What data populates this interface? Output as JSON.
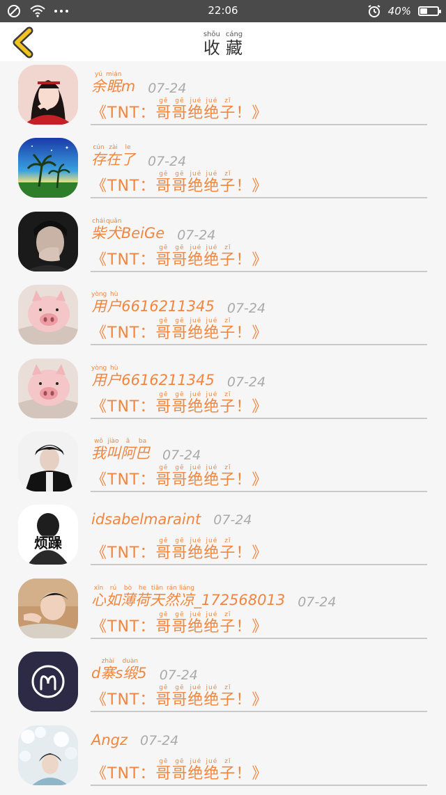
{
  "status": {
    "time": "22:06",
    "battery": "40%",
    "battery_level": 0.4
  },
  "header": {
    "title": [
      {
        "char": "收",
        "pinyin": "shōu"
      },
      {
        "char": "藏",
        "pinyin": "cáng"
      }
    ]
  },
  "message_parts": {
    "open": "《TNT：",
    "close": "！》"
  },
  "message_ruby": [
    {
      "char": "哥",
      "pinyin": "gē"
    },
    {
      "char": "哥",
      "pinyin": "gē"
    },
    {
      "char": "绝",
      "pinyin": "jué"
    },
    {
      "char": "绝",
      "pinyin": "jué"
    },
    {
      "char": "子",
      "pinyin": "zǐ"
    }
  ],
  "items": [
    {
      "avatar": "girl-red-dress",
      "date": "07-24",
      "name": [
        {
          "t": "余",
          "p": "yú"
        },
        {
          "t": "眠",
          "p": "mián"
        },
        {
          "t": "m"
        }
      ]
    },
    {
      "avatar": "palm-tree-landscape",
      "date": "07-24",
      "name": [
        {
          "t": "存",
          "p": "cún"
        },
        {
          "t": "在",
          "p": "zài"
        },
        {
          "t": "了",
          "p": "le"
        }
      ]
    },
    {
      "avatar": "boy-hand-face",
      "date": "07-24",
      "name": [
        {
          "t": "柴",
          "p": "chái"
        },
        {
          "t": "犬",
          "p": "quǎn"
        },
        {
          "t": "BeiGe"
        }
      ]
    },
    {
      "avatar": "pig-face",
      "date": "07-24",
      "name": [
        {
          "t": "用",
          "p": "yòng"
        },
        {
          "t": "户",
          "p": "hù"
        },
        {
          "t": "6616211345"
        }
      ]
    },
    {
      "avatar": "pig-face",
      "date": "07-24",
      "name": [
        {
          "t": "用",
          "p": "yòng"
        },
        {
          "t": "户",
          "p": "hù"
        },
        {
          "t": "6616211345"
        }
      ]
    },
    {
      "avatar": "boy-black-jacket",
      "date": "07-24",
      "name": [
        {
          "t": "我",
          "p": "wǒ"
        },
        {
          "t": "叫",
          "p": "jiào"
        },
        {
          "t": "阿",
          "p": "ā"
        },
        {
          "t": "巴",
          "p": "ba"
        }
      ]
    },
    {
      "avatar": "fanzao-text",
      "avatar_text": "烦躁",
      "date": "07-24",
      "name": [
        {
          "t": "idsabelmaraint"
        }
      ]
    },
    {
      "avatar": "boy-lying",
      "date": "07-24",
      "name": [
        {
          "t": "心",
          "p": "xīn"
        },
        {
          "t": "如",
          "p": "rú"
        },
        {
          "t": "薄",
          "p": "bò"
        },
        {
          "t": "荷",
          "p": "he"
        },
        {
          "t": "天",
          "p": "tiān"
        },
        {
          "t": "然",
          "p": "rán"
        },
        {
          "t": "凉",
          "p": "liáng"
        },
        {
          "t": "_172568013"
        }
      ]
    },
    {
      "avatar": "aries-symbol",
      "date": "07-24",
      "name": [
        {
          "t": "d"
        },
        {
          "t": "寨",
          "p": "zhài"
        },
        {
          "t": "s"
        },
        {
          "t": "缎",
          "p": "duàn"
        },
        {
          "t": "5"
        }
      ]
    },
    {
      "avatar": "girl-flowers",
      "date": "07-24",
      "name": [
        {
          "t": "Angz"
        }
      ]
    }
  ]
}
